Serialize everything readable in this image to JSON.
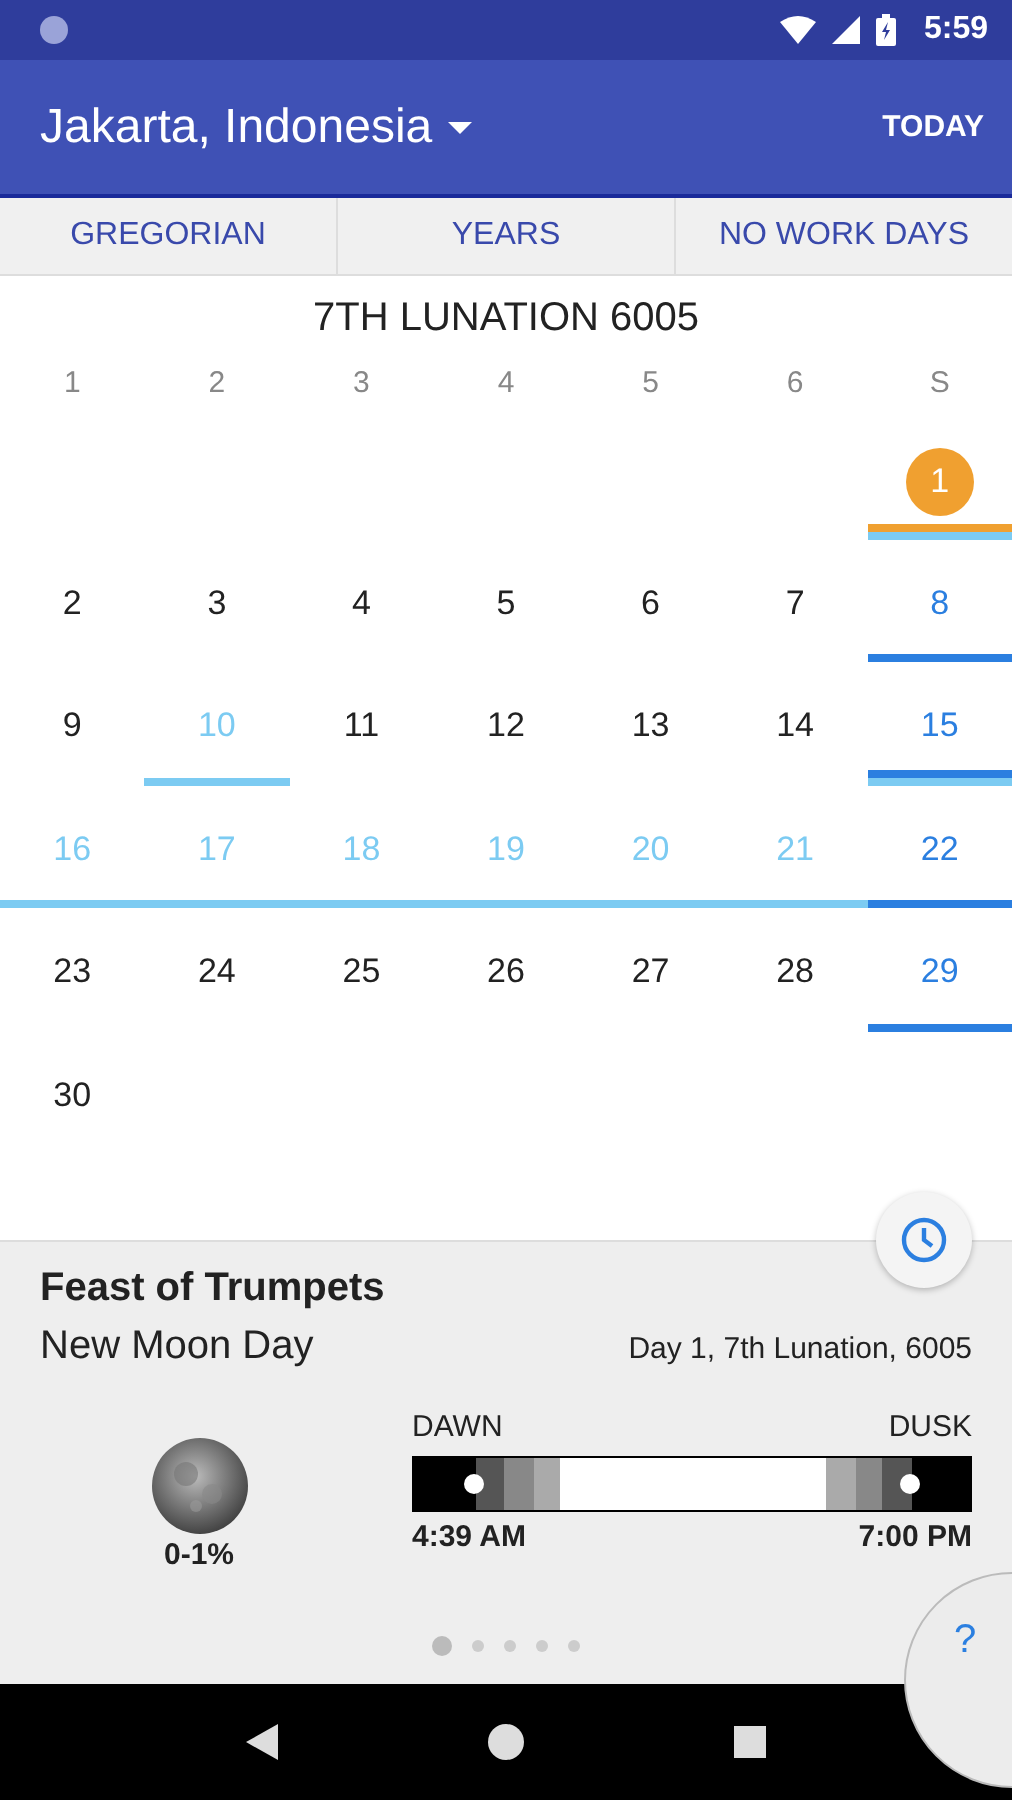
{
  "status_bar": {
    "time": "5:59"
  },
  "app_bar": {
    "location": "Jakarta, Indonesia",
    "action": "TODAY"
  },
  "buttons": [
    "GREGORIAN",
    "YEARS",
    "NO WORK DAYS"
  ],
  "calendar": {
    "title": "7TH LUNATION 6005",
    "weekdays": [
      "1",
      "2",
      "3",
      "4",
      "5",
      "6",
      "S"
    ],
    "weeks": [
      {
        "starts_midweek": true,
        "days": [
          {
            "label": "1",
            "kind": "today",
            "bars": [
              {
                "color": "#f0a030"
              },
              {
                "color": "#7ccbf2"
              }
            ]
          }
        ]
      },
      {
        "days": [
          {
            "label": "2",
            "kind": "regular"
          },
          {
            "label": "3",
            "kind": "regular"
          },
          {
            "label": "4",
            "kind": "regular"
          },
          {
            "label": "5",
            "kind": "regular"
          },
          {
            "label": "6",
            "kind": "regular"
          },
          {
            "label": "7",
            "kind": "regular"
          },
          {
            "label": "8",
            "kind": "sabbath",
            "bars": [
              {
                "color": "#2b7fe0"
              }
            ]
          }
        ]
      },
      {
        "days": [
          {
            "label": "9",
            "kind": "regular"
          },
          {
            "label": "10",
            "kind": "feast",
            "bars": [
              {
                "color": "#7ccbf2"
              }
            ]
          },
          {
            "label": "11",
            "kind": "regular"
          },
          {
            "label": "12",
            "kind": "regular"
          },
          {
            "label": "13",
            "kind": "regular"
          },
          {
            "label": "14",
            "kind": "regular"
          },
          {
            "label": "15",
            "kind": "sabbath",
            "bars": [
              {
                "color": "#2b7fe0"
              },
              {
                "color": "#7ccbf2"
              }
            ]
          }
        ]
      },
      {
        "days": [
          {
            "label": "16",
            "kind": "feast",
            "bars": [
              {
                "color": "#7ccbf2"
              }
            ]
          },
          {
            "label": "17",
            "kind": "feast",
            "bars": [
              {
                "color": "#7ccbf2"
              }
            ]
          },
          {
            "label": "18",
            "kind": "feast",
            "bars": [
              {
                "color": "#7ccbf2"
              }
            ]
          },
          {
            "label": "19",
            "kind": "feast",
            "bars": [
              {
                "color": "#7ccbf2"
              }
            ]
          },
          {
            "label": "20",
            "kind": "feast",
            "bars": [
              {
                "color": "#7ccbf2"
              }
            ]
          },
          {
            "label": "21",
            "kind": "feast",
            "bars": [
              {
                "color": "#7ccbf2"
              }
            ]
          },
          {
            "label": "22",
            "kind": "sabbath",
            "bars": [
              {
                "color": "#2b7fe0"
              }
            ]
          }
        ]
      },
      {
        "days": [
          {
            "label": "23",
            "kind": "regular"
          },
          {
            "label": "24",
            "kind": "regular"
          },
          {
            "label": "25",
            "kind": "regular"
          },
          {
            "label": "26",
            "kind": "regular"
          },
          {
            "label": "27",
            "kind": "regular"
          },
          {
            "label": "28",
            "kind": "regular"
          },
          {
            "label": "29",
            "kind": "sabbath",
            "bars": [
              {
                "color": "#2b7fe0"
              }
            ]
          }
        ]
      },
      {
        "days": [
          {
            "label": "30",
            "kind": "regular"
          }
        ]
      }
    ]
  },
  "details": {
    "title": "Feast of Trumpets",
    "subtitle": "New Moon Day",
    "date": "Day 1, 7th Lunation, 6005",
    "moon": {
      "phase": "0-1%"
    },
    "daylight": {
      "dawn_label": "DAWN",
      "dusk_label": "DUSK",
      "dawn_time": "4:39 AM",
      "dusk_time": "7:00 PM"
    },
    "pages": [
      {
        "selected": true
      },
      {
        "selected": false
      },
      {
        "selected": false
      },
      {
        "selected": false
      },
      {
        "selected": false
      }
    ],
    "help": "?"
  }
}
